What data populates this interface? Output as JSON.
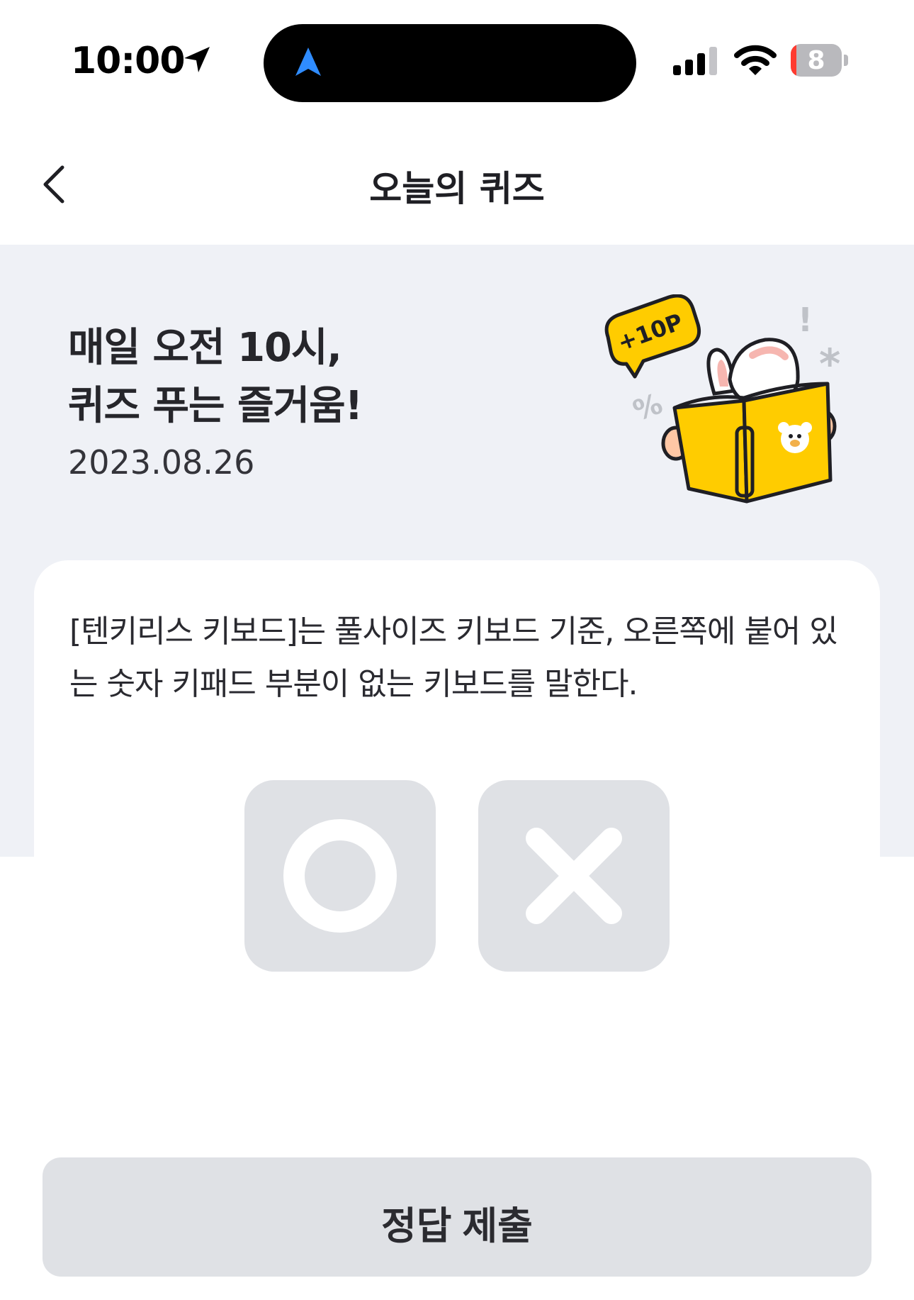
{
  "status_bar": {
    "time": "10:00",
    "battery": "8"
  },
  "nav": {
    "title": "오늘의 퀴즈",
    "back_icon": "chevron-left-icon"
  },
  "hero": {
    "headline_line1": "매일 오전 10시,",
    "headline_line2": "퀴즈 푸는 즐거움!",
    "date": "2023.08.26",
    "badge": "+10P"
  },
  "quiz": {
    "question": "[텐키리스 키보드]는 풀사이즈 키보드 기준, 오른쪽에 붙어 있는 숫자 키패드 부분이 없는 키보드를 말한다.",
    "options": [
      {
        "icon": "circle-o-icon",
        "label": "O"
      },
      {
        "icon": "x-mark-icon",
        "label": "X"
      }
    ]
  },
  "submit": {
    "label": "정답 제출"
  },
  "colors": {
    "hero_bg": "#eff1f6",
    "button_bg": "#dfe1e5",
    "accent_yellow": "#ffcc00",
    "nav_blue": "#2f8cff",
    "battery_red": "#ff3b30"
  }
}
